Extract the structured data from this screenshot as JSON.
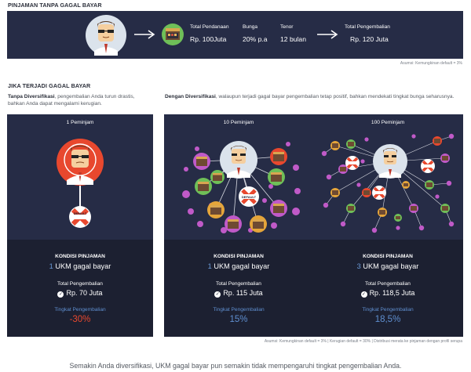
{
  "section1": {
    "title": "PINJAMAN TANPA GAGAL BAYAR",
    "funding_label": "Total Pendanaan",
    "funding_value": "Rp. 100Juta",
    "interest_label": "Bunga",
    "interest_value": "20% p.a",
    "tenor_label": "Tenor",
    "tenor_value": "12 bulan",
    "return_label": "Total Pengembalian",
    "return_value": "Rp. 120 Juta",
    "assumption": "Asumsi: Kemungkinan default = 3%"
  },
  "section2": {
    "title": "JIKA TERJADI GAGAL BAYAR",
    "left_lead_bold": "Tanpa Diversifikasi",
    "left_lead_text": ", pengembalian Anda turun drastis, bahkan Anda dapat mengalami kerugian.",
    "right_lead_bold": "Dengan Diversifikasi",
    "right_lead_text": ", walaupun terjadi gagal bayar pengembalian tetap positif, bahkan mendekati tingkat bunga seharusnya.",
    "default_tag": "DEFAULT",
    "panels": [
      {
        "label": "1 Peminjam",
        "cond_title": "KONDISI PINJAMAN",
        "cond_num": "1",
        "cond_text": " UKM gagal bayar",
        "ret_label": "Total Pengembalian",
        "ret_value": "Rp. 70 Juta",
        "rate_label": "Tingkat Pengembalian",
        "rate_value": "-30%"
      },
      {
        "label": "10 Peminjam",
        "cond_title": "KONDISI PINJAMAN",
        "cond_num": "1",
        "cond_text": " UKM gagal bayar",
        "ret_label": "Total Pengembalian",
        "ret_value": "Rp. 115 Juta",
        "rate_label": "Tingkat Pengembalian",
        "rate_value": "15%"
      },
      {
        "label": "100 Peminjam",
        "cond_title": "KONDISI PINJAMAN",
        "cond_num": "3",
        "cond_text": " UKM gagal bayar",
        "ret_label": "Total Pengembalian",
        "ret_value": "Rp. 118,5 Juta",
        "rate_label": "Tingkat Pengembalian",
        "rate_value": "18,5%"
      }
    ],
    "footnote": "Asumsi: Kemungkinan default = 3% | Kerugian default = 30% | Distribusi merata ke pinjaman dengan profil serupa"
  },
  "bottom_note": "Semakin Anda diversifikasi, UKM gagal bayar pun semakin tidak mempengaruhi tingkat pengembalian Anda.",
  "colors": {
    "navy": "#262c46",
    "panel_bottom": "#1c2031",
    "negative": "#e8482e",
    "positive": "#5f8fd0",
    "default_red": "#e8482e"
  },
  "icons": {
    "investor": "investor-face-icon",
    "arrow": "arrow-right-icon",
    "shop": "shop-icon",
    "default": "default-x-icon",
    "check": "check-circle-icon"
  }
}
